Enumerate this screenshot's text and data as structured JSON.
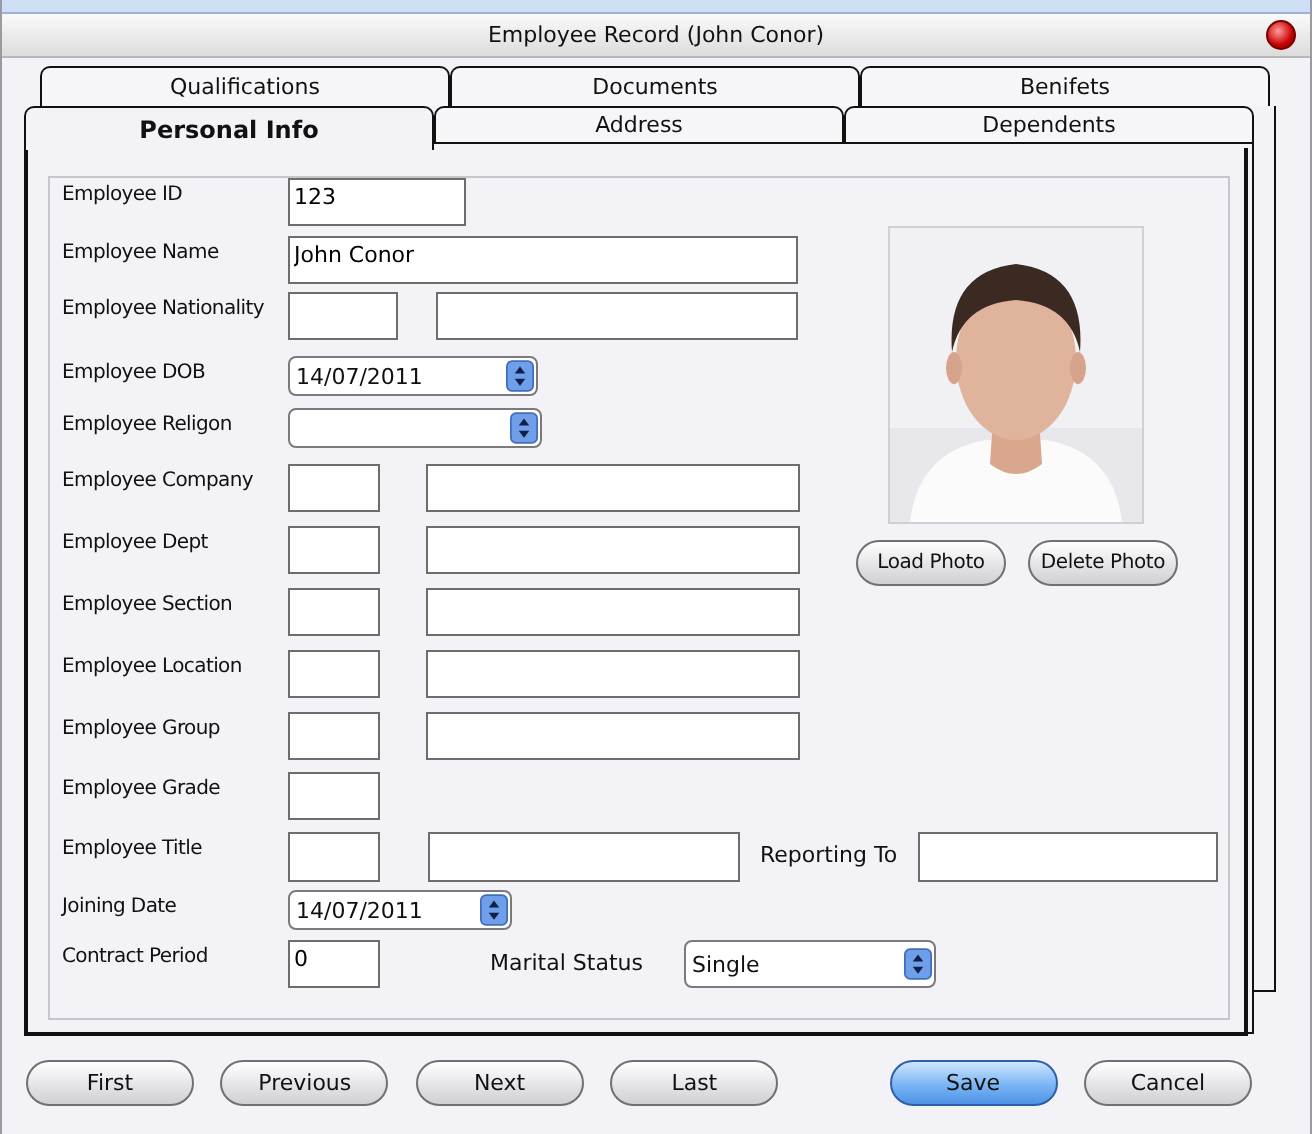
{
  "window": {
    "title": "Employee Record (John Conor)"
  },
  "tabs": {
    "back_row": [
      {
        "label": "Qualifications",
        "selected": false
      },
      {
        "label": "Documents",
        "selected": false
      },
      {
        "label": "Benifets",
        "selected": false
      }
    ],
    "front_row": [
      {
        "label": "Personal Info",
        "selected": true
      },
      {
        "label": "Address",
        "selected": false
      },
      {
        "label": "Dependents",
        "selected": false
      }
    ]
  },
  "form_rows": [
    {
      "label": "Employee ID",
      "controls": [
        {
          "kind": "input",
          "value": "123"
        }
      ]
    },
    {
      "label": "Employee Name",
      "controls": [
        {
          "kind": "input",
          "value": "John Conor"
        }
      ]
    },
    {
      "label": "Employee Nationality",
      "controls": [
        {
          "kind": "input"
        },
        {
          "kind": "input"
        }
      ]
    },
    {
      "label": "Employee DOB",
      "controls": [
        {
          "kind": "dropdown",
          "value": "14/07/2011"
        }
      ]
    },
    {
      "label": "Employee Religon",
      "controls": [
        {
          "kind": "dropdown"
        }
      ]
    },
    {
      "label": "Employee Company",
      "controls": [
        {
          "kind": "input"
        },
        {
          "kind": "input"
        }
      ]
    },
    {
      "label": "Employee Dept",
      "controls": [
        {
          "kind": "input"
        },
        {
          "kind": "input"
        }
      ]
    },
    {
      "label": "Employee Section",
      "controls": [
        {
          "kind": "input"
        },
        {
          "kind": "input"
        }
      ]
    },
    {
      "label": "Employee Location",
      "controls": [
        {
          "kind": "input"
        },
        {
          "kind": "input"
        }
      ]
    },
    {
      "label": "Employee Group",
      "controls": [
        {
          "kind": "input"
        },
        {
          "kind": "input"
        }
      ]
    },
    {
      "label": "Employee Grade",
      "controls": [
        {
          "kind": "input"
        }
      ]
    },
    {
      "label": "Employee Title",
      "controls": [
        {
          "kind": "input"
        },
        {
          "kind": "input"
        },
        {
          "kind": "label",
          "text": "Reporting To"
        },
        {
          "kind": "input"
        }
      ]
    },
    {
      "label": "Joining Date",
      "controls": [
        {
          "kind": "dropdown",
          "value": "14/07/2011"
        }
      ]
    },
    {
      "label": "Contract Period",
      "controls": [
        {
          "kind": "input",
          "value": "0"
        },
        {
          "kind": "label",
          "text": "Marital Status"
        },
        {
          "kind": "dropdown",
          "value": "Single"
        }
      ]
    }
  ],
  "photo": {
    "kind": "picture",
    "buttons": [
      "Load Photo",
      "Delete Photo"
    ]
  },
  "buttons": [
    {
      "label": "First",
      "primary": false
    },
    {
      "label": "Previous",
      "primary": false
    },
    {
      "label": "Next",
      "primary": false
    },
    {
      "label": "Last",
      "primary": false
    },
    {
      "label": "Save",
      "primary": true
    },
    {
      "label": "Cancel",
      "primary": false
    }
  ]
}
